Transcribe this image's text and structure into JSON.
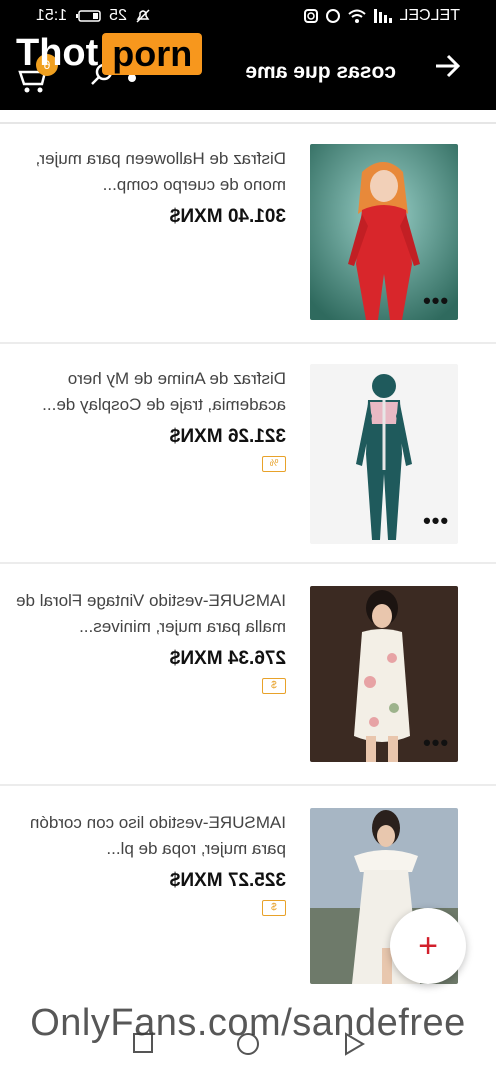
{
  "status_bar": {
    "carrier": "TELCEL",
    "time": "1:51",
    "battery": "25"
  },
  "app_bar": {
    "title": "cosas que ame",
    "cart_badge": "6"
  },
  "items": [
    {
      "title": "Disfraz de Halloween para mujer, mono de cuerpo comp...",
      "price": "301.40 MXN$",
      "tag": ""
    },
    {
      "title": "Disfraz de Anime de My hero academia, traje de Cosplay de...",
      "price": "321.26 MXN$",
      "tag": "%"
    },
    {
      "title": "IAMSURE-vestido Vintage Floral de malla para mujer, minives...",
      "price": "276.34 MXN$",
      "tag": "$"
    },
    {
      "title": "IAMSURE-vestido liso con cordón para mujer, ropa de pl...",
      "price": "325.27 MXN$",
      "tag": "$"
    }
  ],
  "fab": {
    "label": "+"
  },
  "overlay": {
    "watermark": "OnlyFans.com/sandefree",
    "brand_left": "Thot",
    "brand_right": "porn"
  },
  "colors": {
    "bar_bg": "#000000",
    "accent_orange": "#f7971d",
    "fab_plus": "#d21f2b"
  }
}
